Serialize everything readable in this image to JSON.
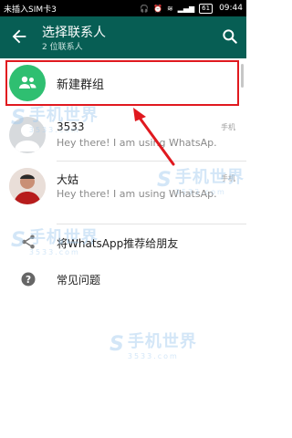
{
  "statusbar": {
    "carrier": "未插入SIM卡3",
    "battery": "61",
    "time": "09:44"
  },
  "appbar": {
    "title": "选择联系人",
    "subtitle": "2 位联系人"
  },
  "new_group": {
    "label": "新建群组"
  },
  "contacts": [
    {
      "name": "3533",
      "status": "Hey there! I am using WhatsAp.",
      "tag": "手机"
    },
    {
      "name": "大姑",
      "status": "Hey there! I am using WhatsAp.",
      "tag": "手机"
    }
  ],
  "actions": {
    "invite": "将WhatsApp推荐给朋友",
    "faq": "常见问题"
  },
  "watermark": {
    "main": "手机世界",
    "sub": "3533.com"
  },
  "colors": {
    "appbar": "#075e54",
    "accent": "#2fbf71",
    "highlight": "#e0191f"
  }
}
